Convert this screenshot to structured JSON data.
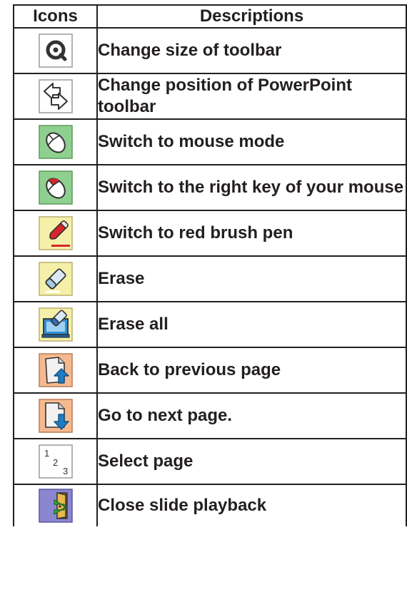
{
  "header": {
    "icons_label": "Icons",
    "descriptions_label": "Descriptions"
  },
  "rows": [
    {
      "icon": "zoom-toolbar-icon",
      "description": "Change size of toolbar"
    },
    {
      "icon": "move-toolbar-arrows-icon",
      "description": "Change position of PowerPoint toolbar"
    },
    {
      "icon": "mouse-mode-icon",
      "description": "Switch to mouse mode"
    },
    {
      "icon": "mouse-right-key-icon",
      "description": "Switch to the right key of your mouse"
    },
    {
      "icon": "red-brush-pen-icon",
      "description": "Switch to red brush pen"
    },
    {
      "icon": "eraser-icon",
      "description": "Erase"
    },
    {
      "icon": "erase-all-icon",
      "description": "Erase all"
    },
    {
      "icon": "previous-page-icon",
      "description": "Back to previous page"
    },
    {
      "icon": "next-page-icon",
      "description": "Go to next page."
    },
    {
      "icon": "select-page-icon",
      "description": "Select page"
    },
    {
      "icon": "close-playback-icon",
      "description": "Close slide playback"
    }
  ],
  "select_page_icon_digits": [
    "1",
    "2",
    "3"
  ],
  "colors": {
    "border": "#231f20",
    "green_bg": "#8fcf8f",
    "yellow_bg": "#f5f0a8",
    "orange_bg": "#f6b98f",
    "purple_bg": "#8a86d0",
    "red": "#d6262b",
    "blue": "#1f7cc4"
  }
}
